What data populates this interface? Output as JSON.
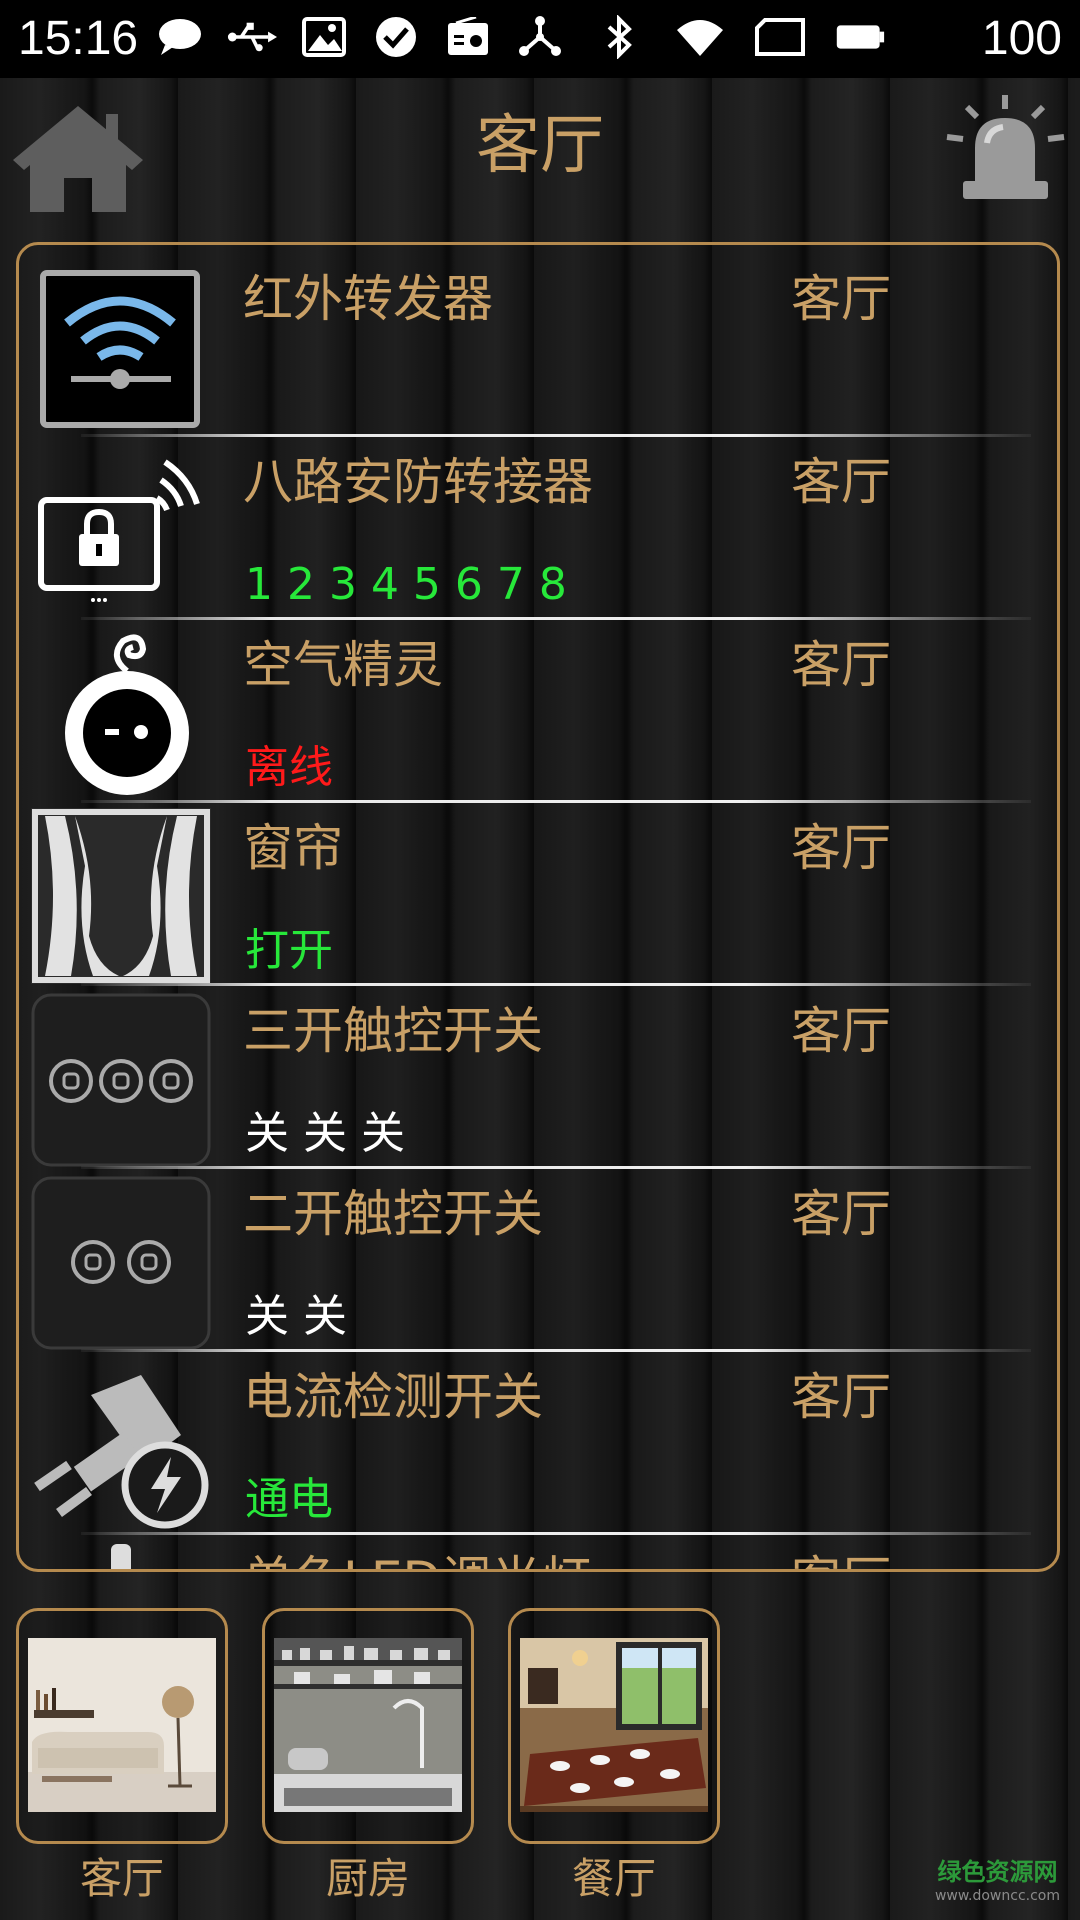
{
  "status_bar": {
    "time": "15:16",
    "battery": "100",
    "left_icons": [
      "chat-icon",
      "usb-icon",
      "image-icon",
      "check-icon",
      "radio-icon",
      "share-icon"
    ],
    "right_icons": [
      "bluetooth-icon",
      "wifi-icon",
      "sim-icon",
      "battery-icon"
    ]
  },
  "header": {
    "title": "客厅",
    "home_icon": "home-icon",
    "alarm_icon": "alarm-siren-icon"
  },
  "devices": [
    {
      "name": "红外转发器",
      "room": "客厅",
      "status": "",
      "status_color": "#ffffff",
      "icon": "ir-transmitter-icon"
    },
    {
      "name": "八路安防转接器",
      "room": "客厅",
      "status": "1 2 3 4 5 6 7 8",
      "status_color": "#27e83a",
      "icon": "security-adapter-icon"
    },
    {
      "name": "空气精灵",
      "room": "客厅",
      "status": "离线",
      "status_color": "#ff1a1a",
      "icon": "air-sprite-icon"
    },
    {
      "name": "窗帘",
      "room": "客厅",
      "status": "打开",
      "status_color": "#27e83a",
      "icon": "curtain-icon"
    },
    {
      "name": "三开触控开关",
      "room": "客厅",
      "status": "关 关 关",
      "status_color": "#ffffff",
      "icon": "triple-switch-icon"
    },
    {
      "name": "二开触控开关",
      "room": "客厅",
      "status": "关 关",
      "status_color": "#ffffff",
      "icon": "double-switch-icon"
    },
    {
      "name": "电流检测开关",
      "room": "客厅",
      "status": "通电",
      "status_color": "#27e83a",
      "icon": "current-plug-icon"
    },
    {
      "name": "单色LED调光灯",
      "room": "客厅",
      "status": "",
      "status_color": "#ffffff",
      "icon": "led-light-icon"
    }
  ],
  "rooms": [
    {
      "label": "客厅",
      "thumb": "living-room-photo"
    },
    {
      "label": "厨房",
      "thumb": "kitchen-photo"
    },
    {
      "label": "餐厅",
      "thumb": "dining-room-photo"
    }
  ],
  "watermark": {
    "main": "绿色资源网",
    "sub": "www.downcc.com"
  },
  "colors": {
    "accent": "#c9a066",
    "border": "#b58a4e",
    "online_green": "#27e83a",
    "offline_red": "#ff1a1a"
  }
}
